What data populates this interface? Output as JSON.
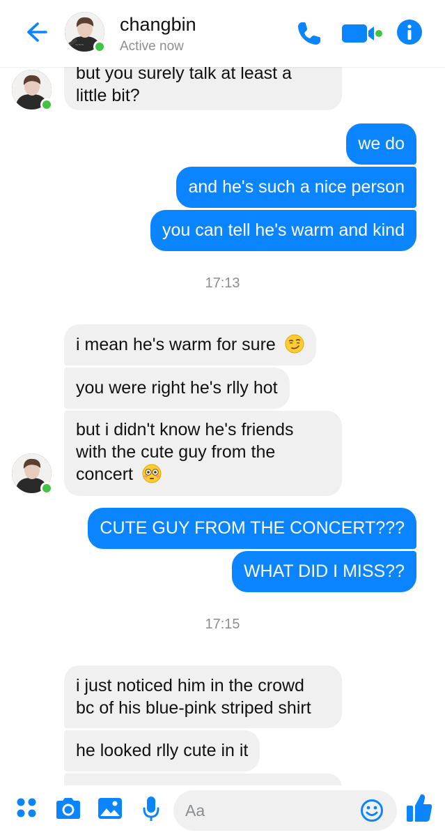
{
  "header": {
    "name": "changbin",
    "status": "Active now",
    "icons": [
      "back-arrow-icon",
      "phone-call-icon",
      "video-camera-icon",
      "info-icon"
    ]
  },
  "messages": [
    {
      "side": "in",
      "lines": [
        "but you surely talk at least a",
        "little bit?"
      ]
    },
    {
      "side": "out",
      "text": "we do"
    },
    {
      "side": "out",
      "text": "and he's such a nice person"
    },
    {
      "side": "out",
      "text": "you can tell he's warm and kind"
    },
    {
      "type": "timestamp",
      "text": "17:13"
    },
    {
      "side": "in",
      "text": "i mean he's warm for sure",
      "emoji": "smirk-emoji"
    },
    {
      "side": "in",
      "text": "you were right he's rlly hot"
    },
    {
      "side": "in",
      "lines": [
        "but i didn't know he's friends",
        "with the cute guy from the",
        "concert"
      ],
      "emoji": "flushed-emoji"
    },
    {
      "side": "out",
      "text": "CUTE GUY FROM THE CONCERT???"
    },
    {
      "side": "out",
      "text": "WHAT DID I MISS??"
    },
    {
      "type": "timestamp",
      "text": "17:15"
    },
    {
      "side": "in",
      "lines": [
        "i just noticed him in the crowd",
        "bc of his blue-pink striped shirt"
      ]
    },
    {
      "side": "in",
      "text": "he looked rlly cute in it"
    }
  ],
  "composer": {
    "placeholder": "Aa",
    "icons": [
      "more-apps-icon",
      "camera-icon",
      "gallery-icon",
      "microphone-icon",
      "emoji-icon",
      "thumbs-up-icon"
    ]
  },
  "colors": {
    "accent": "#0a84ff",
    "incoming": "#f0f0f0",
    "online": "#44c244"
  }
}
